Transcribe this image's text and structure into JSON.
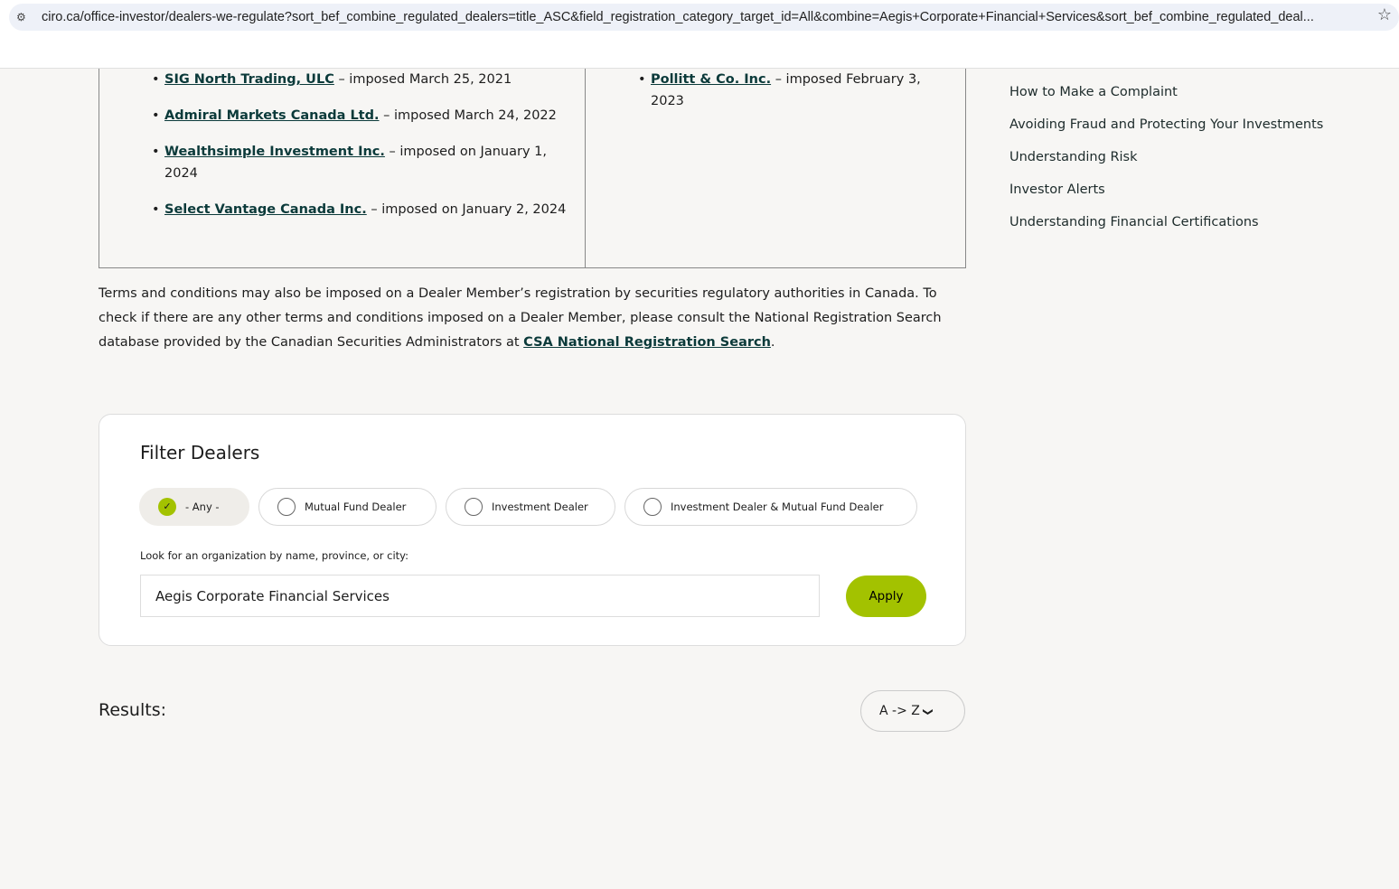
{
  "browser": {
    "url": "ciro.ca/office-investor/dealers-we-regulate?sort_bef_combine_regulated_dealers=title_ASC&field_registration_category_target_id=All&combine=Aegis+Corporate+Financial+Services&sort_bef_combine_regulated_deal..."
  },
  "terms": {
    "left": [
      {
        "name": "SIG North Trading, ULC",
        "text": " – imposed March 25, 2021"
      },
      {
        "name": "Admiral Markets Canada Ltd.",
        "text": " – imposed March 24, 2022"
      },
      {
        "name": "Wealthsimple Investment Inc.",
        "text": " – imposed on January 1, 2024"
      },
      {
        "name": "Select Vantage Canada Inc.",
        "text": " – imposed on January 2, 2024"
      }
    ],
    "right": [
      {
        "name": "Pollitt & Co. Inc.",
        "text": " – imposed February 3, 2023"
      }
    ]
  },
  "sidebar": [
    "How to Make a Complaint",
    "Avoiding Fraud and Protecting Your Investments",
    "Understanding Risk",
    "Investor Alerts",
    "Understanding Financial Certifications"
  ],
  "para": {
    "text": "Terms and conditions may also be imposed on a Dealer Member’s registration by securities regulatory authorities in Canada. To check if there are any other terms and conditions imposed on a Dealer Member, please consult the National Registration Search database provided by the Canadian Securities Administrators at ",
    "link": "CSA National Registration Search",
    "end": "."
  },
  "filter": {
    "title": "Filter Dealers",
    "options": [
      "- Any -",
      "Mutual Fund Dealer",
      "Investment Dealer",
      "Investment Dealer & Mutual Fund Dealer"
    ],
    "label": "Look for an organization by name, province, or city:",
    "value": "Aegis Corporate Financial Services",
    "apply": "Apply"
  },
  "results": {
    "label": "Results:",
    "sort": "A -> Z"
  },
  "colors": {
    "accent": "#a3c200",
    "link": "#0b3a3a"
  }
}
